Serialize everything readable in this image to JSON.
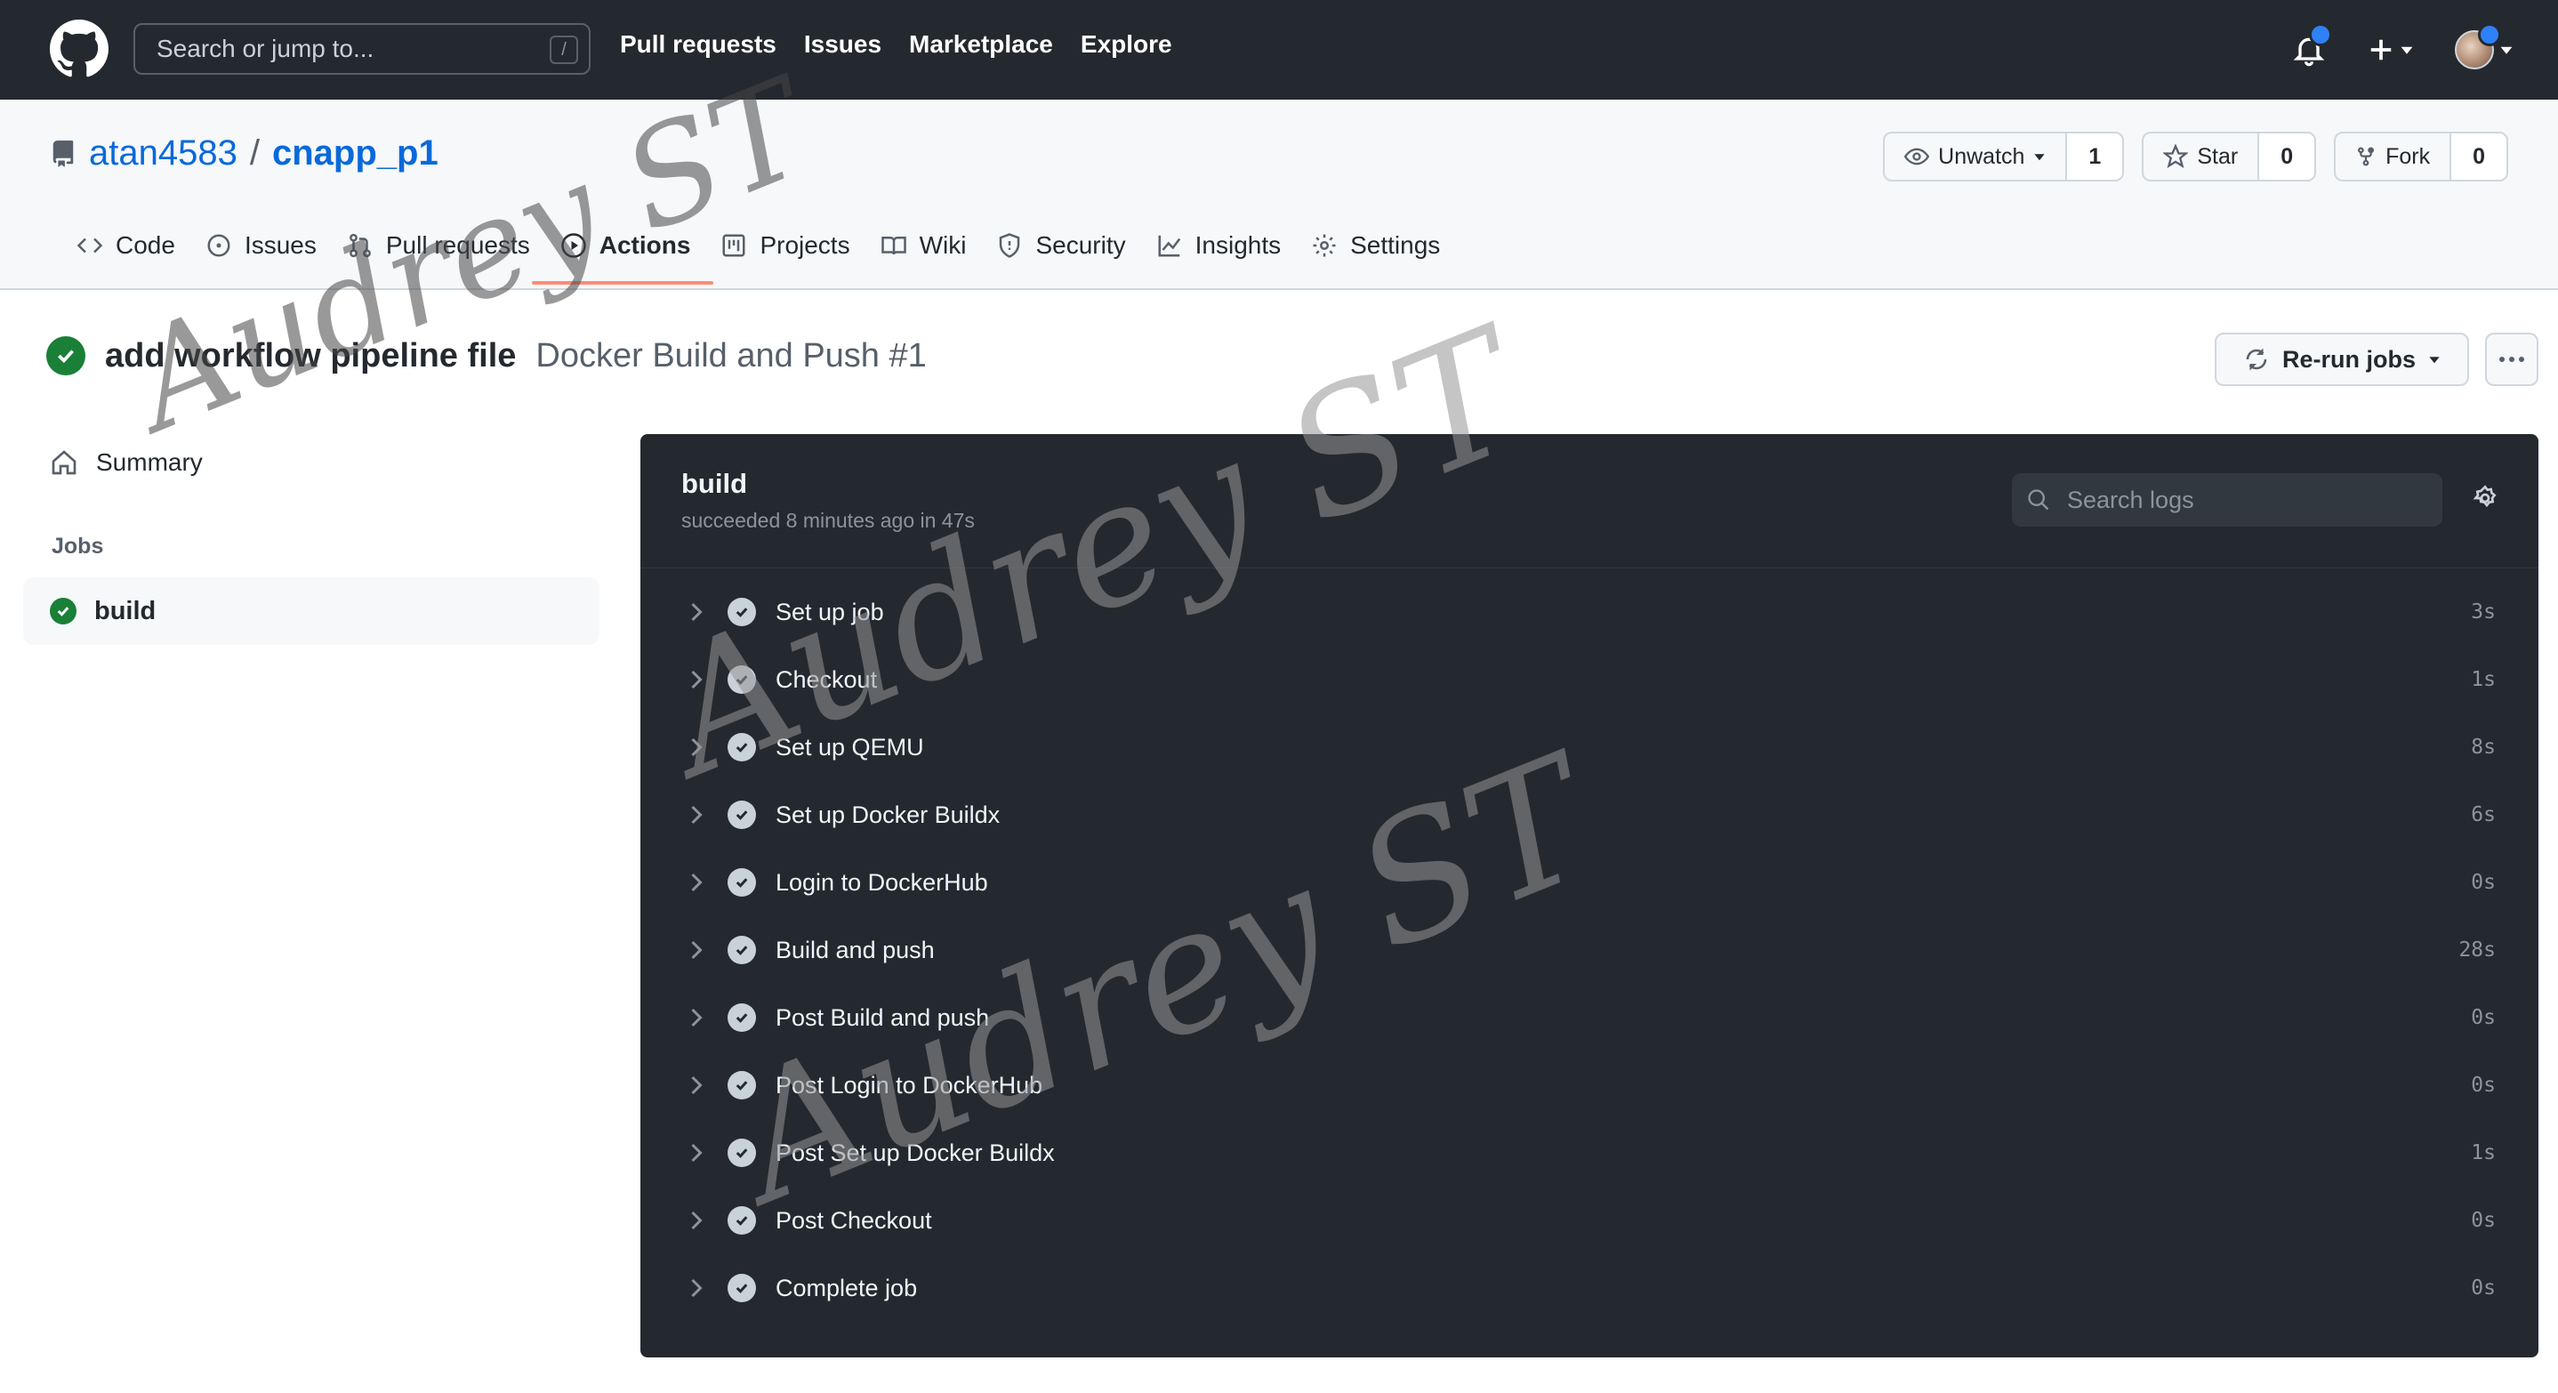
{
  "header": {
    "search_placeholder": "Search or jump to...",
    "search_shortcut": "/",
    "nav": [
      "Pull requests",
      "Issues",
      "Marketplace",
      "Explore"
    ]
  },
  "repo": {
    "owner": "atan4583",
    "separator": "/",
    "name": "cnapp_p1",
    "unwatch_label": "Unwatch",
    "watch_count": "1",
    "star_label": "Star",
    "star_count": "0",
    "fork_label": "Fork",
    "fork_count": "0",
    "tabs": [
      {
        "label": "Code",
        "icon": "code-icon"
      },
      {
        "label": "Issues",
        "icon": "issue-icon"
      },
      {
        "label": "Pull requests",
        "icon": "pull-request-icon"
      },
      {
        "label": "Actions",
        "icon": "play-icon",
        "active": true
      },
      {
        "label": "Projects",
        "icon": "project-icon"
      },
      {
        "label": "Wiki",
        "icon": "book-icon"
      },
      {
        "label": "Security",
        "icon": "shield-icon"
      },
      {
        "label": "Insights",
        "icon": "graph-icon"
      },
      {
        "label": "Settings",
        "icon": "gear-icon"
      }
    ]
  },
  "run": {
    "commit_message": "add workflow pipeline file",
    "workflow_name": "Docker Build and Push #1",
    "rerun_label": "Re-run jobs"
  },
  "sidebar": {
    "summary_label": "Summary",
    "jobs_label": "Jobs",
    "job_name": "build"
  },
  "job": {
    "name": "build",
    "status_text": "succeeded 8 minutes ago in 47s",
    "search_placeholder": "Search logs",
    "steps": [
      {
        "name": "Set up job",
        "duration": "3s"
      },
      {
        "name": "Checkout",
        "duration": "1s"
      },
      {
        "name": "Set up QEMU",
        "duration": "8s"
      },
      {
        "name": "Set up Docker Buildx",
        "duration": "6s"
      },
      {
        "name": "Login to DockerHub",
        "duration": "0s"
      },
      {
        "name": "Build and push",
        "duration": "28s"
      },
      {
        "name": "Post Build and push",
        "duration": "0s"
      },
      {
        "name": "Post Login to DockerHub",
        "duration": "0s"
      },
      {
        "name": "Post Set up Docker Buildx",
        "duration": "1s"
      },
      {
        "name": "Post Checkout",
        "duration": "0s"
      },
      {
        "name": "Complete job",
        "duration": "0s"
      }
    ]
  },
  "watermark": "Audrey ST",
  "colors": {
    "header_bg": "#24292f",
    "link": "#0969da",
    "success": "#1a7f37",
    "active_tab_underline": "#fd8c73",
    "notification_dot": "#2f81f7"
  }
}
